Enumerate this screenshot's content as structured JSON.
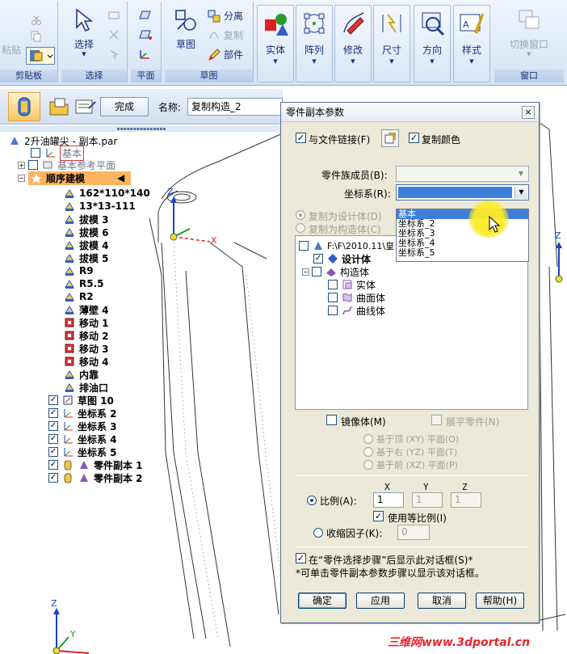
{
  "ribbon": {
    "clipboard": {
      "label": "剪贴板",
      "paste_label": "粘贴"
    },
    "select": {
      "label": "选择",
      "select_label": "选择"
    },
    "plane": {
      "label": "平面"
    },
    "sketch": {
      "label": "草图",
      "sketch_label": "草图",
      "separate_label": "分离",
      "copy_label": "复制",
      "part_label": "部件"
    },
    "tiles": [
      "实体",
      "阵列",
      "修改",
      "尺寸",
      "方向",
      "样式"
    ],
    "window": {
      "label": "窗口",
      "switch_label": "切换窗口"
    }
  },
  "strip": {
    "finish_label": "完成",
    "name_label": "名称:",
    "name_value": "复制构造_2"
  },
  "tree": {
    "file": "2升油罐尖 - 副本.par",
    "base": "基本",
    "base_planes": "基本参考平面",
    "ordered": "顺序建模",
    "features": [
      "162*110*140",
      "13*13-111",
      "拔模 3",
      "拔模 6",
      "拔模 4",
      "拔模 5",
      "R9",
      "R5.5",
      "R2",
      "薄壁 4",
      "移动 1",
      "移动 2",
      "移动 3",
      "移动 4",
      "内靠",
      "排油口",
      "草图 10",
      "坐标系 2",
      "坐标系 3",
      "坐标系 4",
      "坐标系 5",
      "零件副本 1",
      "零件副本 2"
    ]
  },
  "dialog": {
    "title": "零件副本参数",
    "link_label": "与文件链接(F)",
    "copy_color_label": "复制颜色",
    "family_label": "零件族成员(B):",
    "cs_label": "坐标系(R):",
    "cs_options": [
      "基本",
      "坐标系_2",
      "坐标系_3",
      "坐标系_4",
      "坐标系_5"
    ],
    "cs_selected": "基本",
    "copy_design_label": "复制为设计体(D)",
    "copy_construct_label": "复制为构造体(C)",
    "panel": {
      "root": "F:\\F\\2010.11\\皇",
      "design_body": "设计体",
      "construct": "构造体",
      "solid": "实体",
      "surface": "曲面体",
      "curve": "曲线体"
    },
    "mirror_label": "镜像体(M)",
    "flatten_label": "展平零件(N)",
    "top_plane": "基于顶 (XY) 平面(O)",
    "right_plane": "基于右 (YZ) 平面(T)",
    "front_plane": "基于前 (XZ) 平面(P)",
    "col_x": "X",
    "col_y": "Y",
    "col_z": "Z",
    "scale_label": "比例(A):",
    "scale_x": "1",
    "scale_y": "1",
    "scale_z": "1",
    "uniform_label": "使用等比例(I)",
    "shrink_label": "收缩因子(K):",
    "shrink_value": "0",
    "show_dialog_label": "在“零件选择步骤”后显示此对话框(S)*",
    "note": "*可单击零件副本参数步骤以显示该对话框。",
    "ok": "确定",
    "apply": "应用",
    "cancel": "取消",
    "help": "帮助(H)"
  },
  "viewport": {
    "axis_x": "X",
    "axis_y": "Y",
    "axis_z": "Z"
  },
  "watermark": "三维网www.3dportal.cn"
}
